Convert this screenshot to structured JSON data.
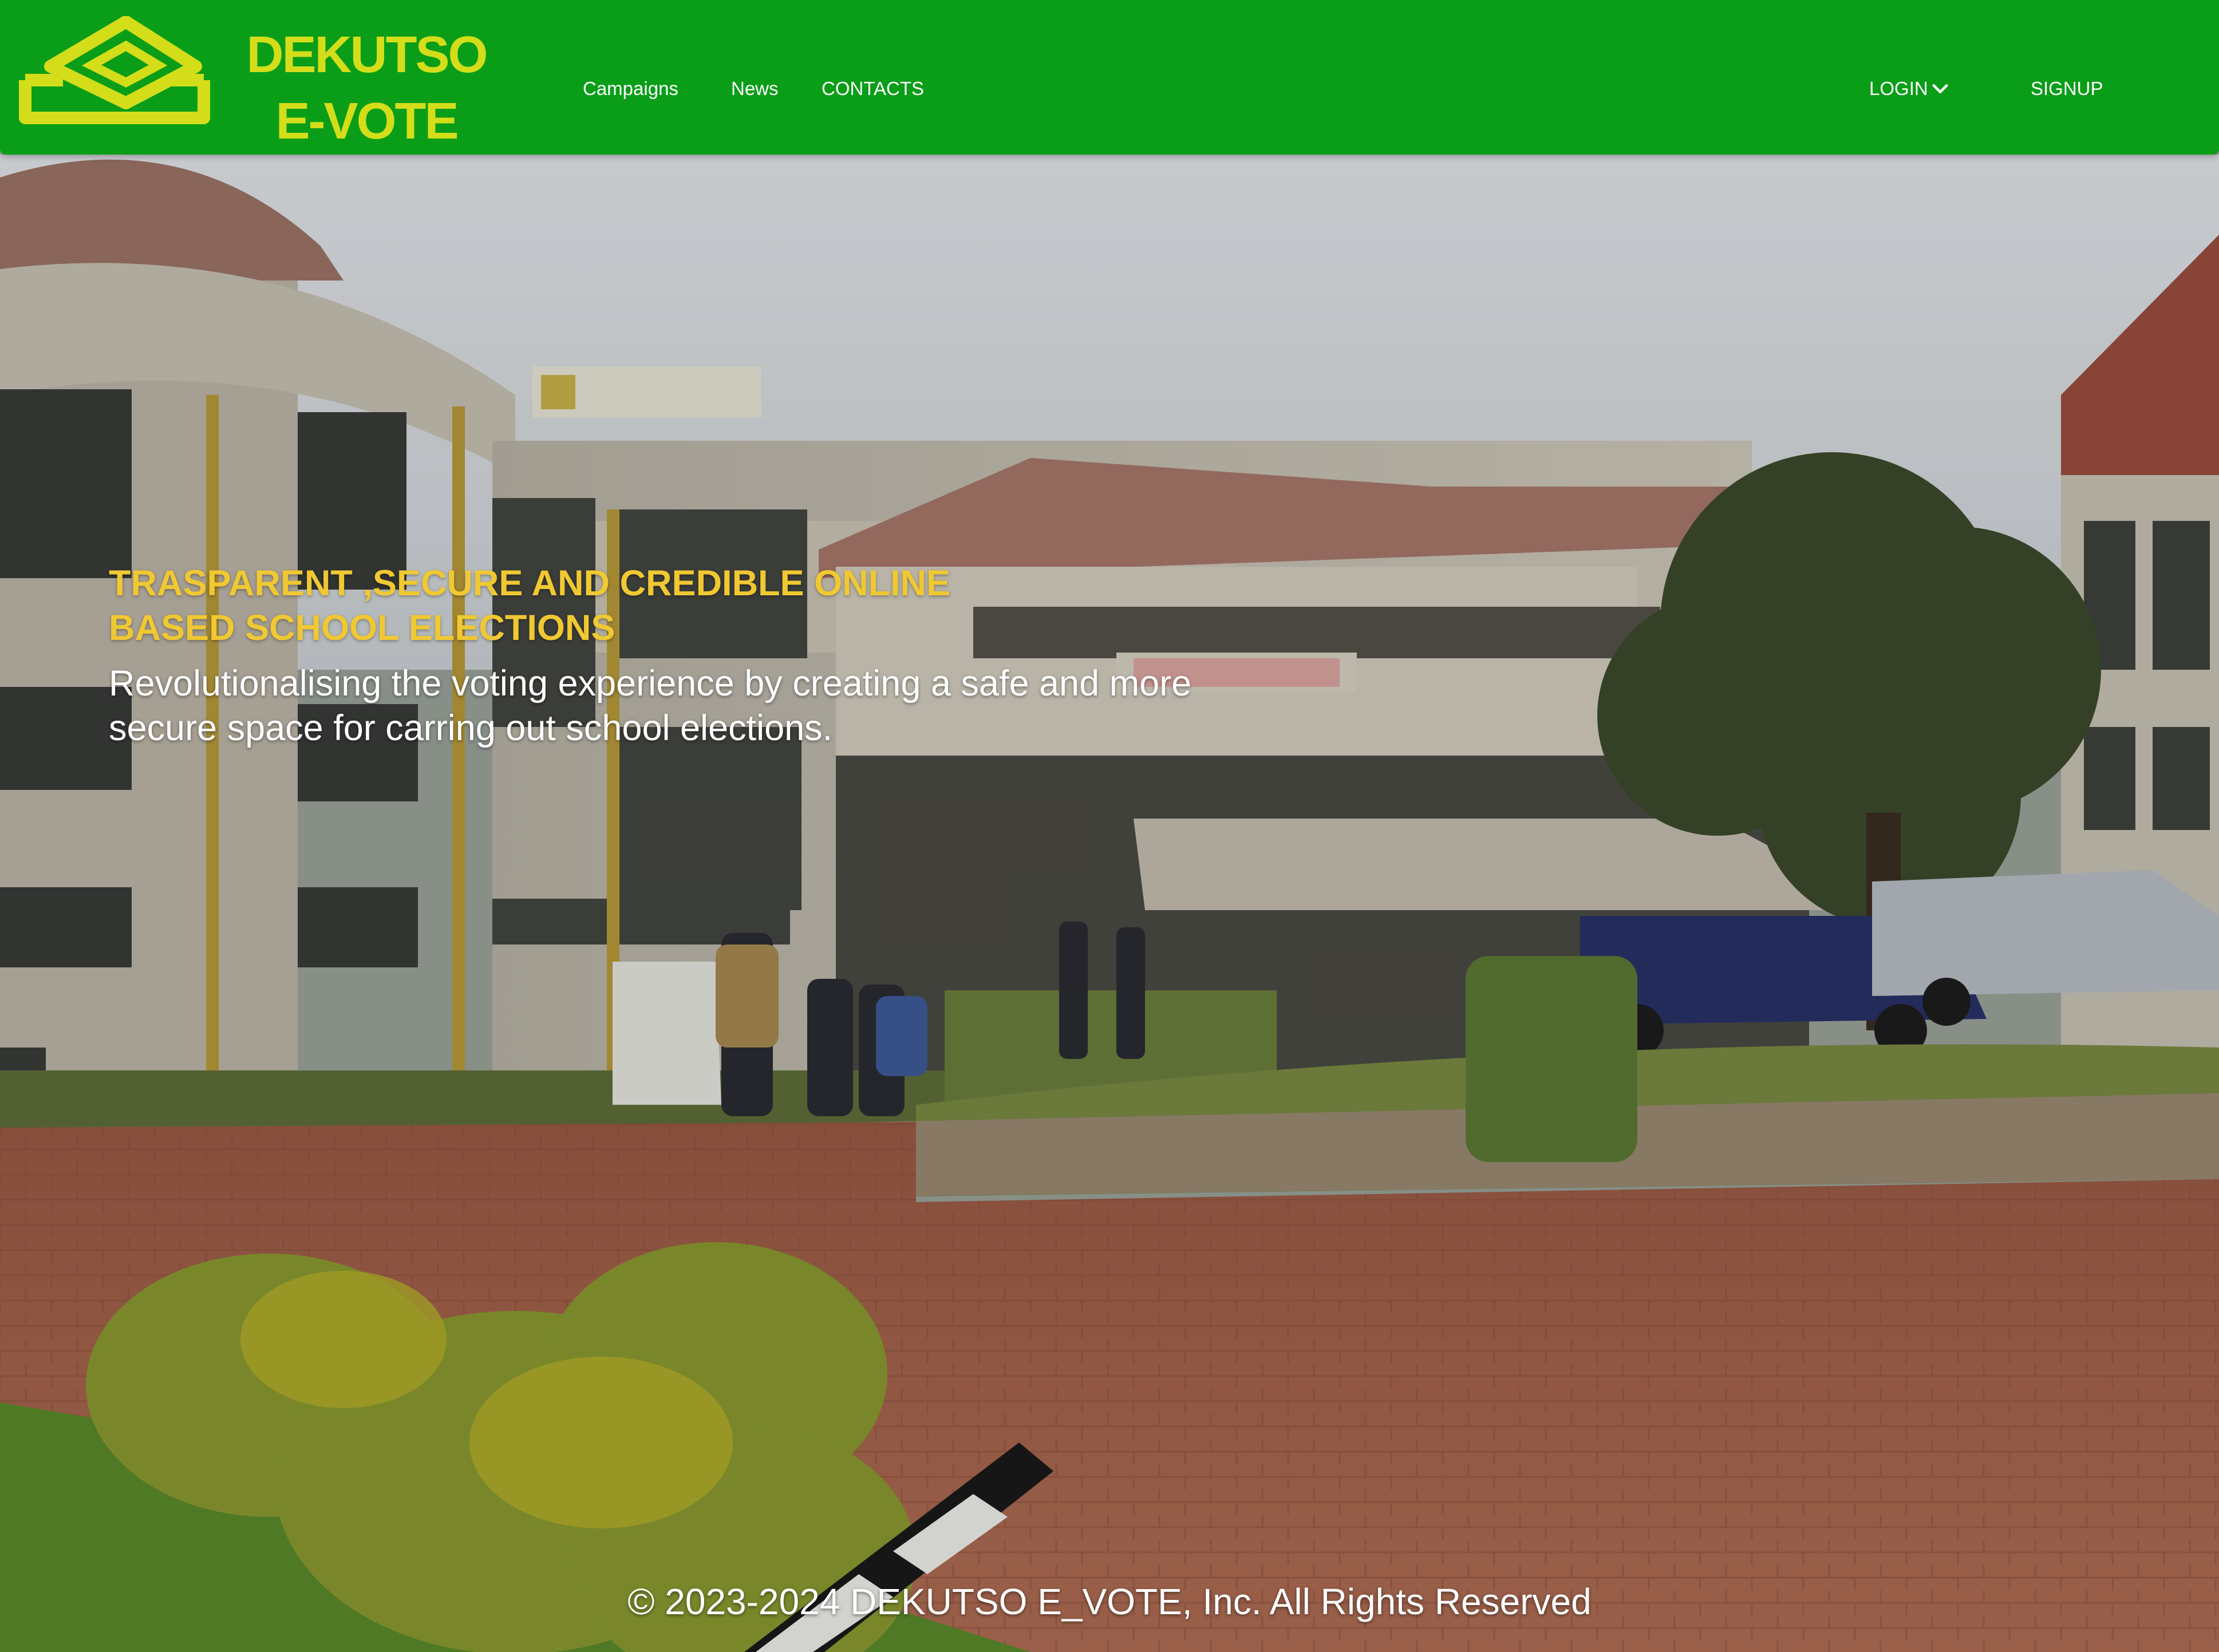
{
  "brand": {
    "line1": "DEKUTSO",
    "line2": "E-VOTE",
    "logo_icon": "ballot-box-icon"
  },
  "nav": {
    "campaigns": "Campaigns",
    "news": "News",
    "contacts": "CONTACTS",
    "login": "LOGIN",
    "signup": "SIGNUP"
  },
  "hero": {
    "headline": "TRASPARENT ,SECURE AND CREDIBLE ONLINE BASED SCHOOL ELECTIONS",
    "tagline": "Revolutionalising the voting experience by creating a safe and more secure space for carring out school elections."
  },
  "footer": {
    "copyright": "© 2023-2024 DEKUTSO E_VOTE, Inc. All Rights Reserved"
  },
  "colors": {
    "navbar": "#0a9e18",
    "brand": "#d4dd1a",
    "headline": "#f0c832",
    "nav_text": "#ffffff"
  }
}
